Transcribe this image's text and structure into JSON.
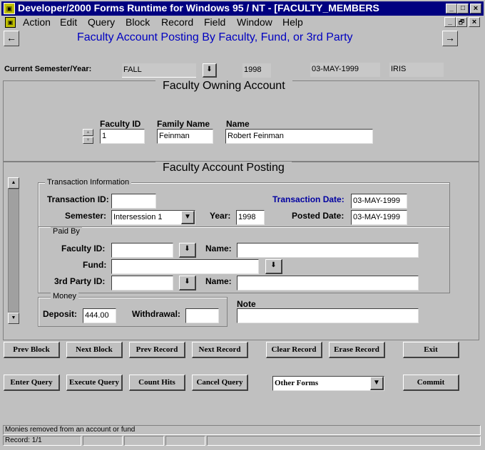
{
  "window": {
    "title": "Developer/2000 Forms Runtime for Windows 95 / NT - [FACULTY_MEMBERS",
    "controls": [
      "_",
      "□",
      "×"
    ]
  },
  "menu": {
    "items": [
      "Action",
      "Edit",
      "Query",
      "Block",
      "Record",
      "Field",
      "Window",
      "Help"
    ],
    "mdi_controls": [
      "_",
      "🗗",
      "×"
    ]
  },
  "header": {
    "title": "Faculty Account Posting By Faculty, Fund, or 3rd Party",
    "title_color": "#0000c0",
    "left_arrow": "←",
    "right_arrow": "→"
  },
  "semester_bar": {
    "label": "Current Semester/Year:",
    "semester": "FALL",
    "year": "1998",
    "date": "03-MAY-1999",
    "user": "IRIS"
  },
  "owning": {
    "title": "Faculty Owning Account",
    "faculty_id_label": "Faculty ID",
    "family_name_label": "Family Name",
    "name_label": "Name",
    "faculty_id": "1",
    "family_name": "Feinman",
    "name": "Robert  Feinman"
  },
  "posting": {
    "title": "Faculty Account Posting",
    "transaction": {
      "group_title": "Transaction Information",
      "transaction_id_label": "Transaction ID:",
      "transaction_id": "",
      "transaction_date_label": "Transaction Date:",
      "transaction_date": "03-MAY-1999",
      "semester_label": "Semester:",
      "semester": "Intersession 1",
      "year_label": "Year:",
      "year": "1998",
      "posted_date_label": "Posted Date:",
      "posted_date": "03-MAY-1999"
    },
    "paid_by": {
      "group_title": "Paid By",
      "faculty_id_label": "Faculty ID:",
      "faculty_id": "",
      "name_label": "Name:",
      "name": "",
      "fund_label": "Fund:",
      "fund": "",
      "third_party_label": "3rd Party ID:",
      "third_party_id": "",
      "name2_label": "Name:",
      "name2": ""
    },
    "money": {
      "group_title": "Money",
      "deposit_label": "Deposit:",
      "deposit": "444.00",
      "withdrawal_label": "Withdrawal:",
      "withdrawal": ""
    },
    "note_label": "Note",
    "note": ""
  },
  "buttons": {
    "row1": [
      "Prev Block",
      "Next Block",
      "Prev Record",
      "Next Record",
      "Clear Record",
      "Erase Record",
      "Exit"
    ],
    "row2": [
      "Enter Query",
      "Execute Query",
      "Count Hits",
      "Cancel Query",
      "Commit"
    ],
    "other_forms": "Other Forms"
  },
  "status": {
    "message": "Monies removed from an account or fund",
    "record": "Record: 1/1"
  },
  "colors": {
    "title_bar": "#000080",
    "window_bg": "#c0c0c0"
  }
}
